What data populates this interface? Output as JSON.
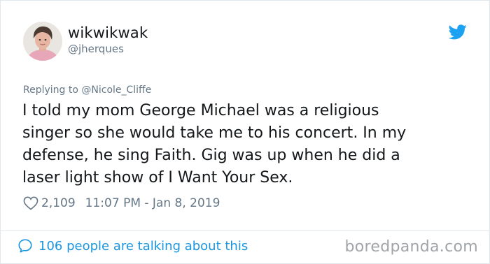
{
  "tweet": {
    "display_name": "wikwikwak",
    "handle": "@jherques",
    "replying_to": "Replying to @Nicole_Cliffe",
    "text": "I told my mom George Michael was a religious\nsinger so she would take me to his concert. In my\ndefense, he sing Faith. Gig was up when he did a\nlaser light show of I Want Your Sex.",
    "likes": "2,109",
    "timestamp": "11:07 PM - Jan 8, 2019",
    "talking": "106 people are talking about this"
  },
  "watermark": "boredpanda.com",
  "icons": {
    "brand": "twitter-bird-icon",
    "like": "heart-icon",
    "reply": "speech-bubble-icon"
  },
  "colors": {
    "twitter_blue": "#1da1f2",
    "link_blue": "#1b95e0",
    "text": "#14171a",
    "muted": "#657786",
    "watermark": "#a0a4a8"
  }
}
